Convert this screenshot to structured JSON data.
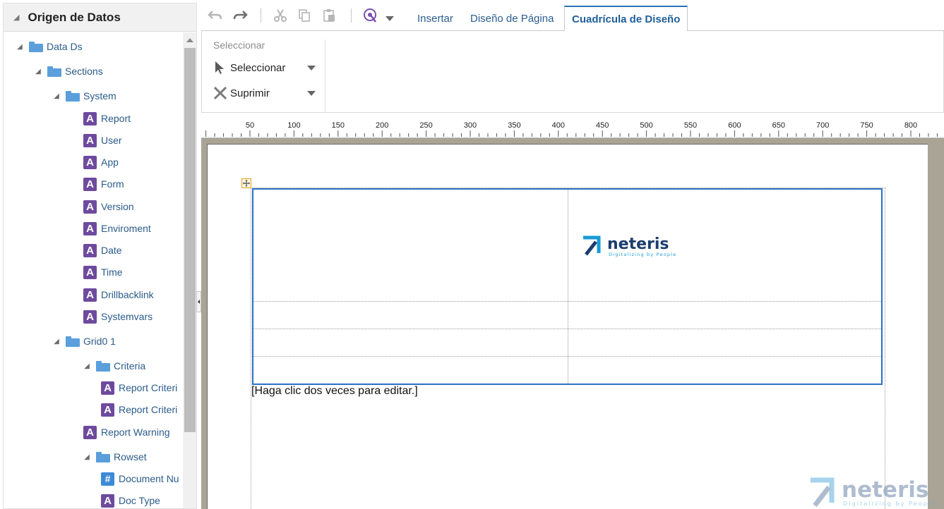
{
  "panel": {
    "title": "Origen de Datos",
    "tree": [
      {
        "label": "Data Ds",
        "kind": "folder",
        "depth": 0,
        "expanded": true
      },
      {
        "label": "Sections",
        "kind": "folder",
        "depth": 1,
        "expanded": true
      },
      {
        "label": "System",
        "kind": "folder",
        "depth": 2,
        "expanded": true
      },
      {
        "label": "Report",
        "kind": "attr",
        "depth": 3
      },
      {
        "label": "User",
        "kind": "attr",
        "depth": 3
      },
      {
        "label": "App",
        "kind": "attr",
        "depth": 3
      },
      {
        "label": "Form",
        "kind": "attr",
        "depth": 3
      },
      {
        "label": "Version",
        "kind": "attr",
        "depth": 3
      },
      {
        "label": "Enviroment",
        "kind": "attr",
        "depth": 3
      },
      {
        "label": "Date",
        "kind": "attr",
        "depth": 3
      },
      {
        "label": "Time",
        "kind": "attr",
        "depth": 3
      },
      {
        "label": "Drillbacklink",
        "kind": "attr",
        "depth": 3
      },
      {
        "label": "Systemvars",
        "kind": "attr",
        "depth": 3
      },
      {
        "label": "Grid0 1",
        "kind": "folder",
        "depth": 2,
        "expanded": true
      },
      {
        "label": "Criteria",
        "kind": "folder",
        "depth": 3,
        "expanded": true
      },
      {
        "label": "Report Criteri",
        "kind": "attr",
        "depth": 4
      },
      {
        "label": "Report Criteri",
        "kind": "attr",
        "depth": 4
      },
      {
        "label": "Report Warning",
        "kind": "attr",
        "depth": 3
      },
      {
        "label": "Rowset",
        "kind": "folder",
        "depth": 3,
        "expanded": true
      },
      {
        "label": "Document Nu",
        "kind": "num",
        "depth": 4
      },
      {
        "label": "Doc Type",
        "kind": "attr",
        "depth": 4
      }
    ]
  },
  "toolbar": {
    "tabs": [
      {
        "label": "Insertar",
        "active": false
      },
      {
        "label": "Diseño de Página",
        "active": false
      },
      {
        "label": "Cuadrícula de Diseño",
        "active": true
      }
    ]
  },
  "ribbon": {
    "group_title": "Seleccionar",
    "select_label": "Seleccionar",
    "delete_label": "Suprimir"
  },
  "ruler": {
    "labels": [
      "50",
      "100",
      "150",
      "200",
      "250",
      "300",
      "350",
      "400",
      "450",
      "500",
      "550",
      "600",
      "650",
      "700",
      "750",
      "800"
    ]
  },
  "canvas": {
    "edit_hint": "[Haga clic dos veces para editar.]",
    "logo_name": "neteris",
    "logo_tagline": "Digitalizing by People"
  },
  "colors": {
    "link_blue": "#2b5b8a",
    "attr_purple": "#6d4a9e",
    "folder_blue": "#5a9fdc",
    "grid_border": "#2a72c3",
    "canvas_bg": "#aaa496"
  }
}
